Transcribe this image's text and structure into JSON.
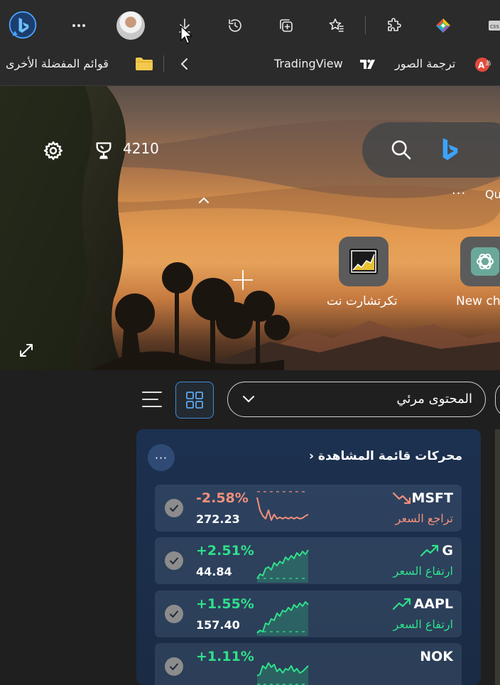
{
  "toolbar": {
    "icons": [
      "bing-chat-icon",
      "more-options-icon",
      "profile-avatar",
      "downloads-icon",
      "history-icon",
      "collections-icon",
      "favorites-icon",
      "extensions-icon",
      "extension-color-icon",
      "css-extension-icon"
    ]
  },
  "favorites_bar": {
    "other_favorites_label": "قوائم المفضلة الأخرى",
    "items": [
      {
        "label": "TradingView",
        "icon": "tradingview-icon"
      },
      {
        "label": "ترجمة الصور",
        "icon": "translate-icon"
      }
    ]
  },
  "hero": {
    "points": "4210",
    "search_suggestion_prefix": "Qu",
    "tiles": [
      {
        "label": "تكرتشارت نت",
        "icon": "chart-icon"
      },
      {
        "label": "New ch",
        "icon": "chatgpt-icon"
      }
    ]
  },
  "feed": {
    "content_select_label": "المحتوى مرئي"
  },
  "watchlist": {
    "title": "محركات قائمة المشاهدة",
    "colors": {
      "up": "#2fe08a",
      "down": "#f3907a"
    },
    "rows": [
      {
        "symbol": "MSFT",
        "change": "-2.58%",
        "price": "272.23",
        "trend": "تراجع السعر",
        "direction": "down"
      },
      {
        "symbol": "G",
        "change": "+2.51%",
        "price": "44.84",
        "trend": "ارتفاع السعر",
        "direction": "up"
      },
      {
        "symbol": "AAPL",
        "change": "+1.55%",
        "price": "157.40",
        "trend": "ارتفاع السعر",
        "direction": "up"
      },
      {
        "symbol": "NOK",
        "change": "+1.11%",
        "price": "",
        "trend": "",
        "direction": "up"
      }
    ]
  }
}
